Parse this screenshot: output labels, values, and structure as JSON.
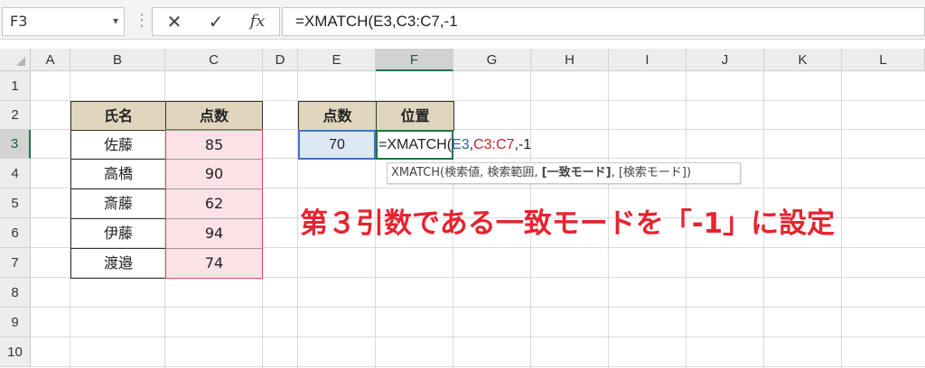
{
  "formula_bar": {
    "name_box": "F3",
    "name_box_arrow": "▾",
    "separator": "⋮",
    "cancel_glyph": "✕",
    "enter_glyph": "✓",
    "fx_glyph": "fx",
    "formula": "=XMATCH(E3,C3:C7,-1"
  },
  "columns": [
    "A",
    "B",
    "C",
    "D",
    "E",
    "F",
    "G",
    "H",
    "I",
    "J",
    "K",
    "L"
  ],
  "selected_column": "F",
  "rows": [
    "1",
    "2",
    "3",
    "4",
    "5",
    "6",
    "7",
    "8",
    "9",
    "10"
  ],
  "selected_row": "3",
  "table": {
    "headers": [
      "氏名",
      "点数"
    ],
    "names": [
      "佐藤",
      "高橋",
      "斎藤",
      "伊藤",
      "渡邉"
    ],
    "scores": [
      "85",
      "90",
      "62",
      "94",
      "74"
    ]
  },
  "lookup": {
    "header_score": "点数",
    "header_position": "位置",
    "value": "70"
  },
  "cell_formula": {
    "prefix": "=XMATCH(",
    "arg1": "E3",
    "comma1": ",",
    "arg2": "C3:C7",
    "rest": ",-1"
  },
  "tooltip": {
    "fn": "XMATCH(",
    "arg1": "検索値",
    "sep1": ", ",
    "arg2": "検索範囲",
    "sep2": ", ",
    "arg3": "[一致モード]",
    "sep3": ", ",
    "arg4": "[検索モード])"
  },
  "annotation": "第３引数である一致モードを「-1」に設定",
  "colors": {
    "annotation": "#e6232f",
    "header_fill": "#e0d6bd",
    "range_fill": "#fbe2e6",
    "excel_green": "#217346"
  }
}
